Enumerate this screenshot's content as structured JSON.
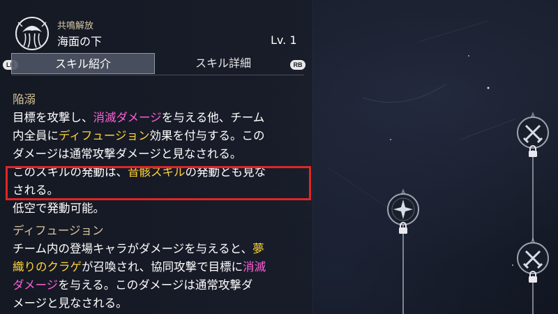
{
  "header": {
    "section_tag": "共鳴解放",
    "skill_name": "海面の下",
    "level": "Lv. 1"
  },
  "tabs": {
    "left_button": "LB",
    "right_button": "RB",
    "items": [
      {
        "label": "スキル紹介",
        "active": true
      },
      {
        "label": "スキル詳細",
        "active": false
      }
    ]
  },
  "content": {
    "heading1": "陥溺",
    "para1": {
      "t1": "目標を攻撃し、",
      "h1": "消滅ダメージ",
      "t2": "を与える他、チーム\n内全員に",
      "h2": "ディフュージョン",
      "t3": "効果を付与する。この\nダメージは通常攻撃ダメージと見なされる。"
    },
    "para2": {
      "t1": "このスキルの発動は、",
      "h1": "音骸スキル",
      "t2": "の発動とも見な\nされる。"
    },
    "para3": "低空で発動可能。",
    "heading2": "ディフュージョン",
    "para4": {
      "t1": "チーム内の登場キャラがダメージを与えると、",
      "h1": "夢\n織りのクラゲ",
      "t2": "が召喚され、協同攻撃で目標に",
      "h2": "消滅\nダメージ",
      "t3": "を与える。このダメージは通常攻撃ダ\nメージと見なされる。"
    }
  },
  "colors": {
    "accent_pink": "#ff5ed8",
    "accent_gold": "#ffd23a",
    "heading": "#d9c59c",
    "highlight_border": "#e02626"
  },
  "icons": {
    "emblem": "jellyfish-emblem-icon",
    "skill_node": "compass-star-icon",
    "locked_node": "crossed-swords-icon",
    "lock": "lock-icon"
  }
}
